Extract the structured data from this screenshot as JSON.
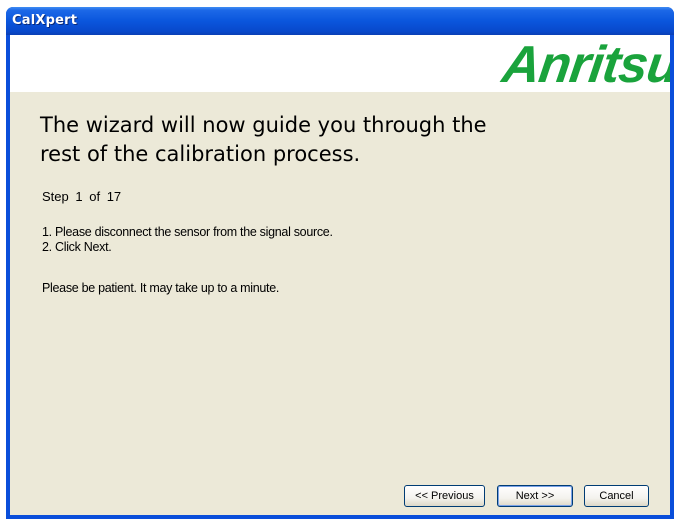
{
  "window": {
    "title": "CalXpert"
  },
  "banner": {
    "logo_text": "Anritsu",
    "logo_color": "#1AA33C"
  },
  "content": {
    "heading_line1": "The wizard will now guide you through the",
    "heading_line2": "rest of the calibration process.",
    "step_label": "Step",
    "step_current": "1",
    "step_of": "of 17",
    "instruction_1": "1. Please disconnect the sensor from the signal source.",
    "instruction_2": "2. Click Next.",
    "note": "Please be patient. It may take up to a minute."
  },
  "buttons": {
    "previous": "<< Previous",
    "next": "Next >>",
    "cancel": "Cancel"
  }
}
